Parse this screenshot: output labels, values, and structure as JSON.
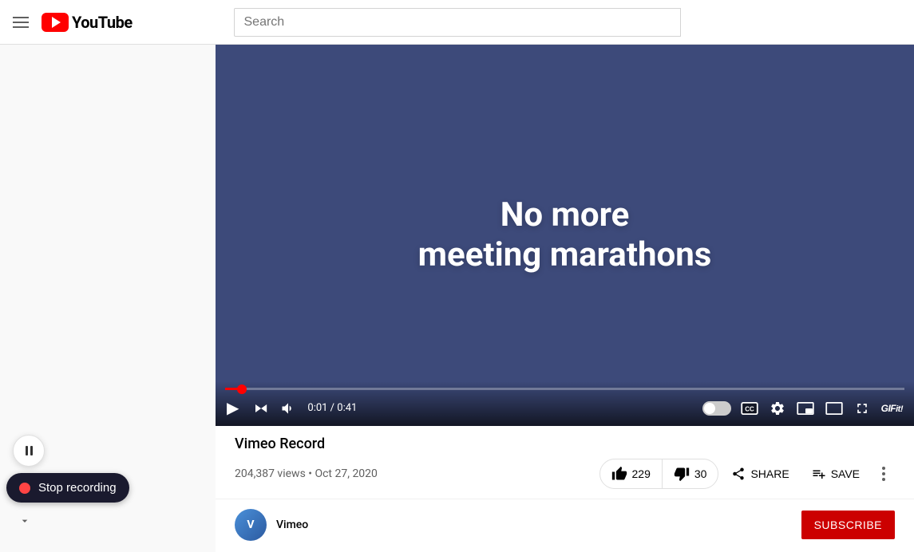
{
  "header": {
    "search_placeholder": "Search",
    "youtube_text": "YouTube"
  },
  "video": {
    "title_line1": "No more",
    "title_line2": "meeting marathons",
    "bg_color": "#3d4a7a",
    "progress_percent": 2.4,
    "current_time": "0:01",
    "total_time": "0:41",
    "time_display": "0:01 / 0:41"
  },
  "video_info": {
    "title": "Vimeo Record",
    "views": "204,387 views",
    "date": "Oct 27, 2020",
    "meta": "204,387 views • Oct 27, 2020",
    "likes": "229",
    "dislikes": "30",
    "like_label": "229",
    "dislike_label": "30",
    "share_label": "SHARE",
    "save_label": "SAVE"
  },
  "channel": {
    "avatar_initials": "V",
    "subscribe_label": "SUBSCRIBE"
  },
  "recording": {
    "stop_label": "Stop recording",
    "rec_dot_color": "#ff4444"
  },
  "controls": {
    "play_icon": "▶",
    "skip_icon": "⏭",
    "volume_icon": "🔊"
  }
}
